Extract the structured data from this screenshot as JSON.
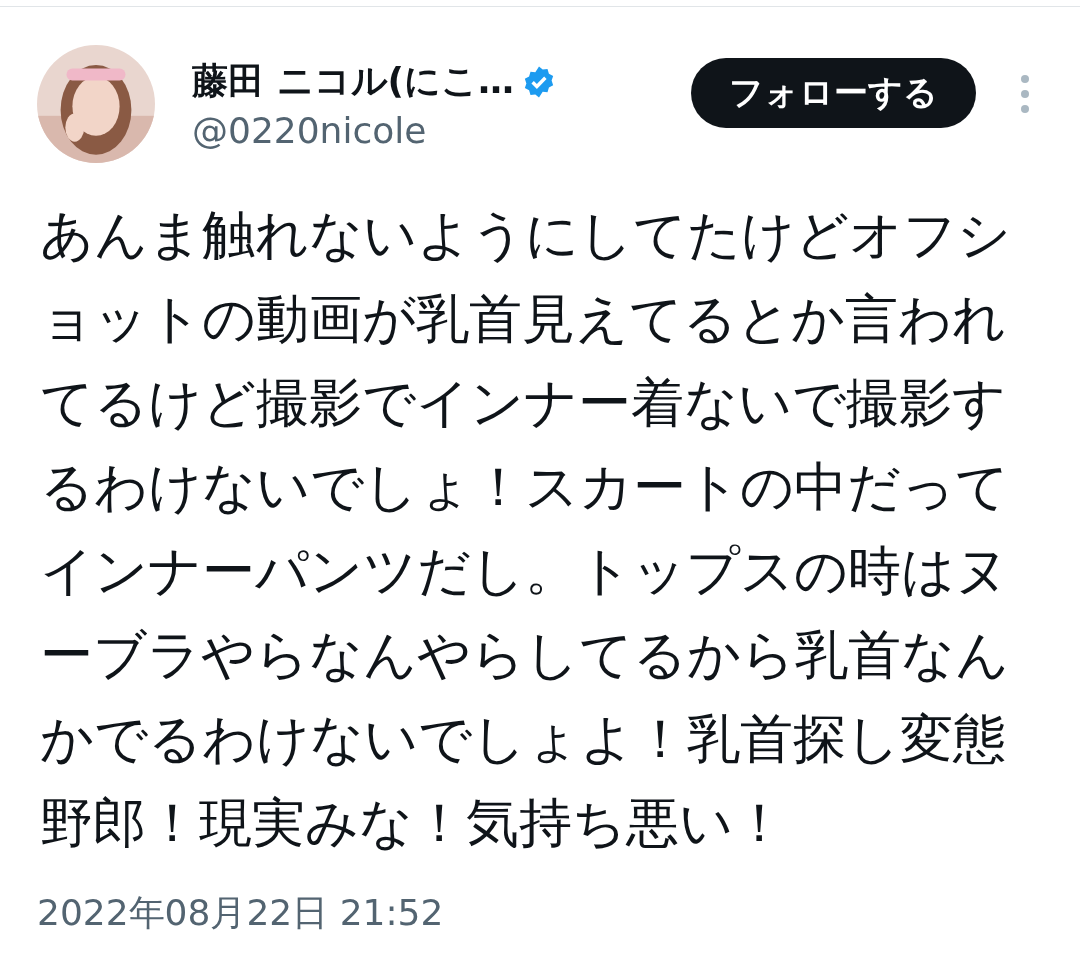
{
  "author": {
    "name": "藤田 ニコル(にこ…",
    "verified": true,
    "handle": "@0220nicole"
  },
  "follow_button": {
    "label": "フォローする"
  },
  "tweet": {
    "text": "あんま触れないようにしてたけどオフショットの動画が乳首見えてるとか言われてるけど撮影でインナー着ないで撮影するわけないでしょ！スカートの中だってインナーパンツだし。トップスの時はヌーブラやらなんやらしてるから乳首なんかでるわけないでしょよ！乳首探し変態野郎！現実みな！気持ち悪い！",
    "timestamp": "2022年08月22日 21:52"
  }
}
